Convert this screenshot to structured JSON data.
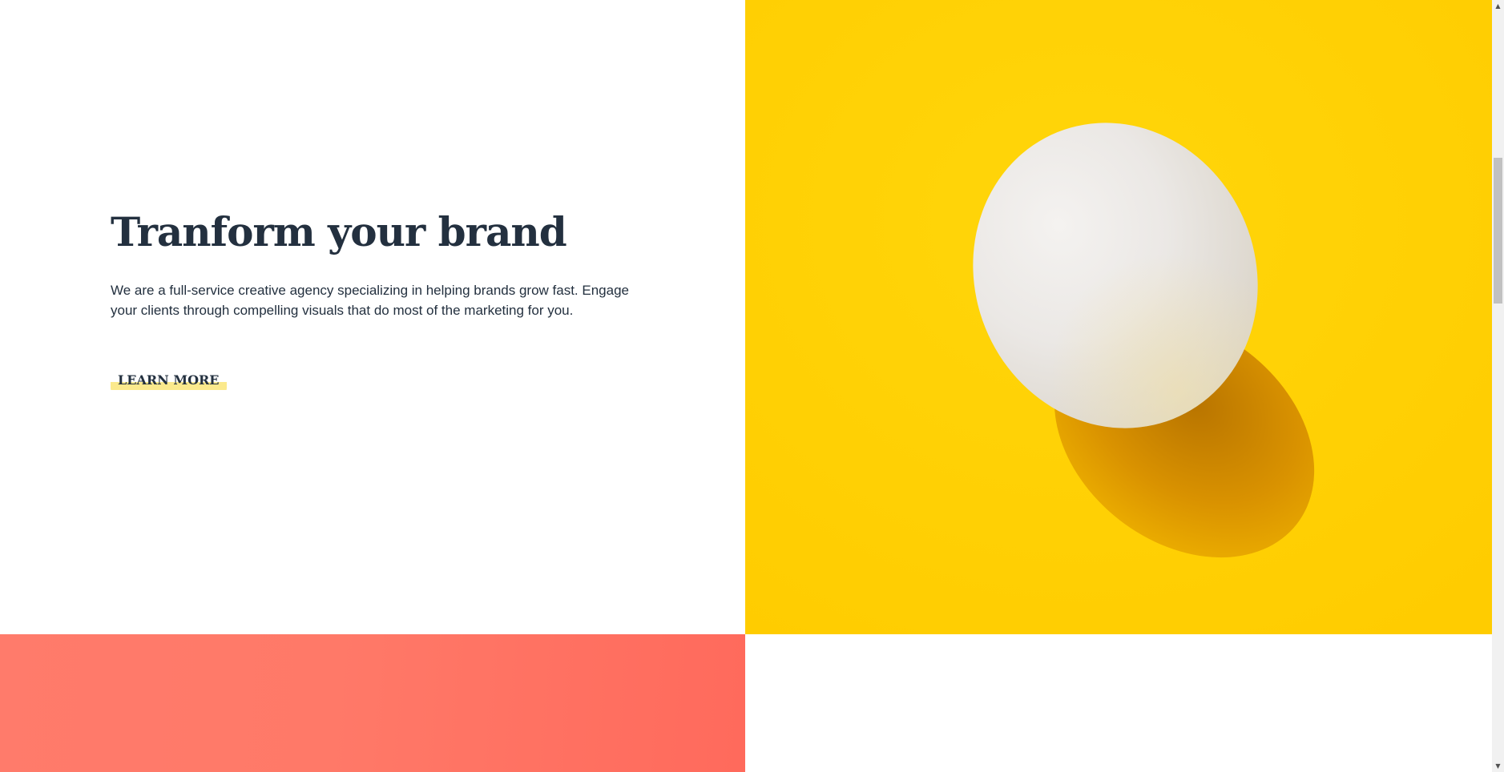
{
  "hero": {
    "title": "Tranform your brand",
    "description": "We are a full-service creative agency specializing in helping brands grow fast. Engage your clients through compelling visuals that do most of the marketing for you.",
    "cta_label": "LEARN MORE"
  },
  "colors": {
    "text_primary": "#23303f",
    "hero_image_background": "#ffd200",
    "cta_highlight": "#fbe98c",
    "coral_section": "#ff7b6b"
  },
  "hero_image": {
    "icon": "egg-photo"
  },
  "scrollbar": {
    "up_arrow": "▲",
    "down_arrow": "▼"
  }
}
